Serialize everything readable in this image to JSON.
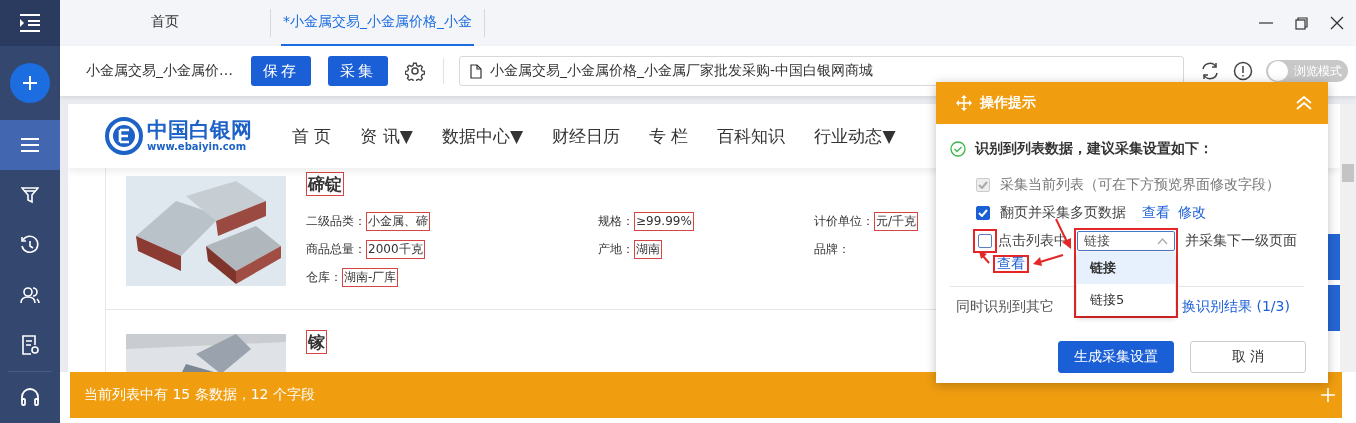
{
  "sidebar": {
    "items": [
      {
        "kind": "collapse",
        "selected": false
      },
      {
        "kind": "add",
        "selected": false
      },
      {
        "kind": "list",
        "selected": true
      },
      {
        "kind": "filter",
        "selected": false
      },
      {
        "kind": "history",
        "selected": false
      },
      {
        "kind": "users",
        "selected": false
      },
      {
        "kind": "task",
        "selected": false
      },
      {
        "kind": "support",
        "selected": false
      }
    ]
  },
  "tabs": [
    {
      "label": "首页",
      "selected": false
    },
    {
      "label": "*小金属交易_小金属价格_小金",
      "selected": true
    }
  ],
  "toolbar": {
    "task_name": "小金属交易_小金属价…",
    "buttons": [
      "保存",
      "采集"
    ],
    "url": "小金属交易_小金属价格_小金属厂家批发采购-中国白银网商城",
    "browse_mode": {
      "label": "浏览模式",
      "on": false
    }
  },
  "site": {
    "logo": {
      "name": "中国白银网",
      "domain": "www.ebaiyin.com"
    },
    "nav": [
      "首 页",
      "资 讯▼",
      "数据中心▼",
      "财经日历",
      "专 栏",
      "百科知识",
      "行业动态▼"
    ],
    "products": [
      {
        "title": "碲锭",
        "image": {
          "kind": "picture"
        },
        "fields": [
          {
            "label": "二级品类：",
            "value": "小金属、碲"
          },
          {
            "label": "规格：",
            "value": "≥99.99%"
          },
          {
            "label": "计价单位：",
            "value": "元/千克"
          },
          {
            "label": "商品总量：",
            "value": "2000千克"
          },
          {
            "label": "产地：",
            "value": "湖南"
          },
          {
            "label": "品牌："
          },
          {
            "label": "仓库：",
            "value": "湖南-厂库"
          }
        ]
      },
      {
        "title": "镓",
        "image": {
          "kind": "picture"
        }
      }
    ]
  },
  "dialog": {
    "title": "操作提示",
    "message": "识别到列表数据，建议采集设置如下：",
    "options": [
      {
        "kind": "checkbox",
        "label": "采集当前列表（可在下方预览界面修改字段）",
        "checked": true,
        "disabled": true
      },
      {
        "kind": "checkbox",
        "label": "翻页并采集多页数据",
        "checked": true,
        "disabled": false,
        "links": [
          "查看",
          "修改"
        ]
      },
      {
        "kind": "select",
        "label": "点击列表中",
        "checked": false,
        "disabled": false,
        "select": {
          "value": "链接",
          "expanded": true,
          "options": [
            {
              "label": "链接",
              "selected": true
            },
            {
              "label": "链接5",
              "selected": false
            }
          ]
        },
        "suffix": "并采集下一级页面",
        "links": [
          "查看"
        ]
      }
    ],
    "other": {
      "text": "同时识别到其它",
      "link": "换识别结果 (1/3)"
    },
    "buttons": [
      {
        "label": "生成采集设置",
        "primary": true
      },
      {
        "label": "取 消",
        "primary": false
      }
    ]
  },
  "status_bar": {
    "text": "当前列表中有 15 条数据，12 个字段"
  }
}
